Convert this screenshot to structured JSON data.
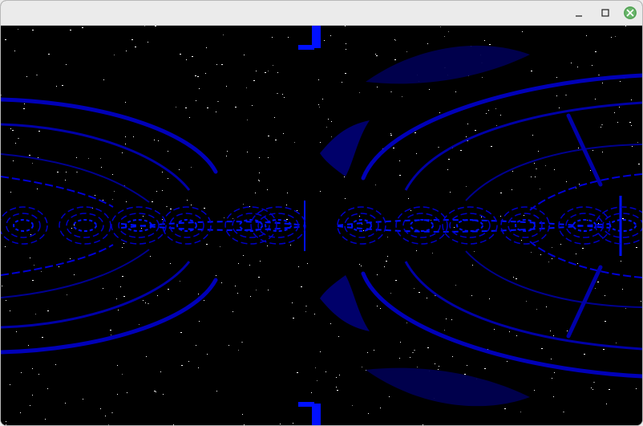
{
  "window": {
    "title": "",
    "controls": {
      "minimize": "minimize",
      "maximize": "maximize",
      "close": "close"
    }
  },
  "visualization": {
    "background": "#000000",
    "colors": {
      "bright_blue": "#0010ff",
      "mid_blue": "#0000c8",
      "dark_blue": "#00006a",
      "deep_blue": "#000050",
      "white": "#ffffff",
      "gray": "#8c8c8c"
    }
  }
}
